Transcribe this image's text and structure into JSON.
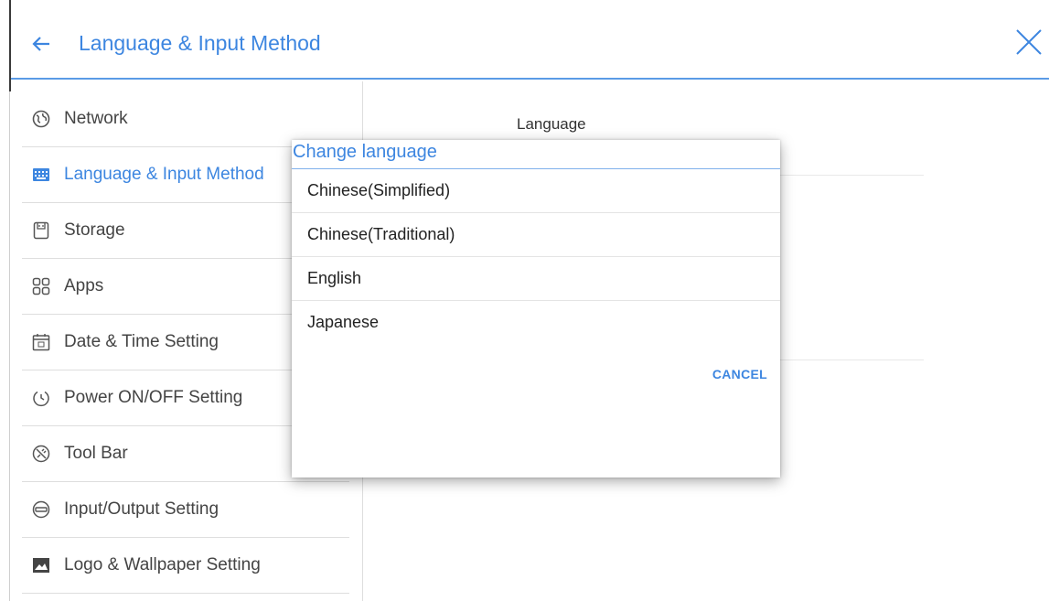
{
  "header": {
    "back_icon": "arrow-left-icon",
    "title": "Language & Input Method",
    "close_icon": "close-icon"
  },
  "sidebar": {
    "items": [
      {
        "label": "Network",
        "icon": "globe-icon"
      },
      {
        "label": "Language & Input Method",
        "icon": "keyboard-icon",
        "active": true
      },
      {
        "label": "Storage",
        "icon": "storage-icon"
      },
      {
        "label": "Apps",
        "icon": "apps-grid-icon"
      },
      {
        "label": "Date & Time Setting",
        "icon": "calendar-icon"
      },
      {
        "label": "Power ON/OFF Setting",
        "icon": "power-timer-icon"
      },
      {
        "label": "Tool Bar",
        "icon": "tools-icon"
      },
      {
        "label": "Input/Output Setting",
        "icon": "input-output-icon"
      },
      {
        "label": "Logo & Wallpaper Setting",
        "icon": "image-icon"
      }
    ]
  },
  "content": {
    "language_label": "Language"
  },
  "dialog": {
    "title": "Change language",
    "options": [
      "Chinese(Simplified)",
      "Chinese(Traditional)",
      "English",
      "Japanese"
    ],
    "cancel_label": "CANCEL"
  },
  "colors": {
    "accent": "#3d86e0",
    "divider": "#dedede"
  }
}
